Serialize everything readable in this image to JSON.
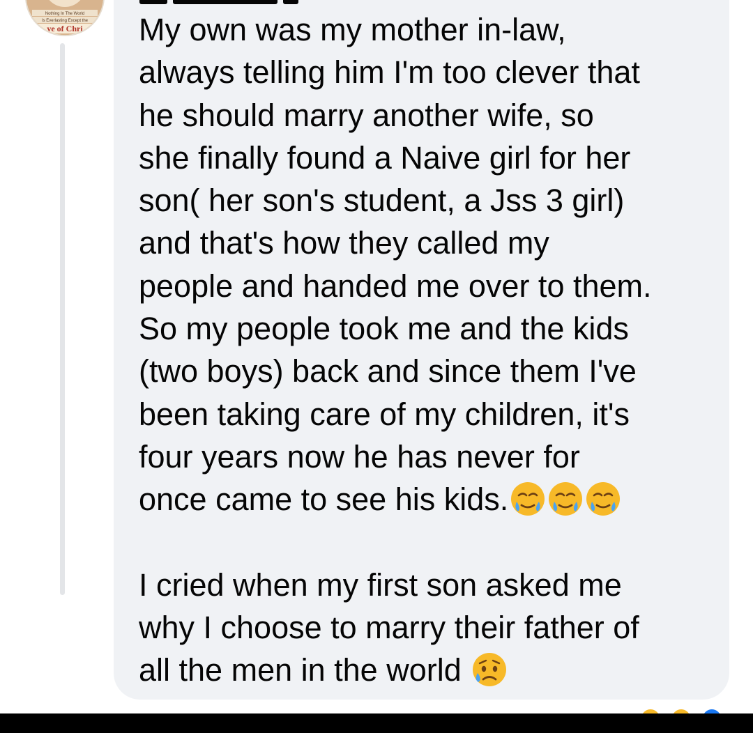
{
  "comment": {
    "paragraph_1": "My own was my mother in-law,\nalways telling him I'm too clever that\nhe should marry another wife, so\nshe finally found a Naive girl for her\nson( her son's student, a Jss 3 girl)\nand that's how they called my\npeople and handed me over to them.\nSo my people took me and the kids\n(two boys) back and since them I've\nbeen taking care of my children, it's\nfour years now he has never for\nonce came to see his kids.",
    "paragraph_1_emojis": [
      "face-holding-back-tears-icon",
      "face-holding-back-tears-icon",
      "face-holding-back-tears-icon"
    ],
    "paragraph_2": "I cried when my first son asked me\nwhy I choose to marry their father of\nall the men in the world",
    "paragraph_2_emoji": "sad-but-relieved-face-icon"
  },
  "avatar": {
    "caption_line_1": "Nothing In The World",
    "caption_line_2": "Is Everlasting Except the",
    "caption_line_3": "ve of Chri"
  },
  "colors": {
    "bubble_background": "#f0f2f5",
    "text": "#050505",
    "thread_line": "#e3e5e8",
    "emoji_yellow": "#f7b928",
    "tear_blue": "#4aa3f0"
  },
  "reactions": [
    "haha-reaction-icon",
    "wow-reaction-icon",
    "like-reaction-icon"
  ]
}
